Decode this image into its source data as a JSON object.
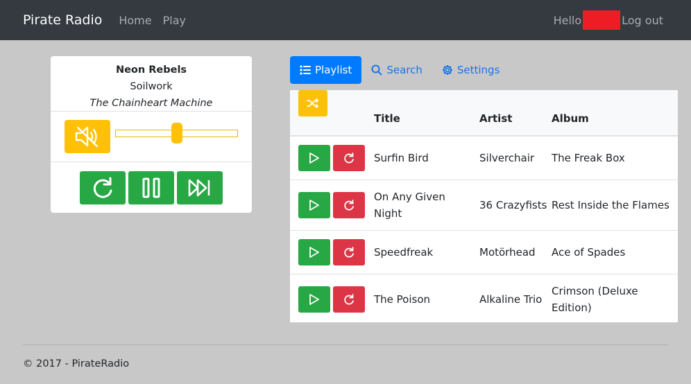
{
  "navbar": {
    "brand": "Pirate Radio",
    "links": [
      "Home",
      "Play"
    ],
    "hello": "Hello",
    "logout": "Log out"
  },
  "player": {
    "song": "Neon Rebels",
    "artist": "Soilwork",
    "album": "The Chainheart Machine",
    "volume_level": 0.5,
    "mute_icon": "volume-mute-icon",
    "controls": [
      "repeat-icon",
      "pause-icon",
      "skip-forward-icon"
    ]
  },
  "tabs": [
    {
      "label": "Playlist",
      "icon": "list-icon",
      "active": true
    },
    {
      "label": "Search",
      "icon": "search-icon",
      "active": false
    },
    {
      "label": "Settings",
      "icon": "gear-icon",
      "active": false
    }
  ],
  "playlist": {
    "columns": [
      "Title",
      "Artist",
      "Album"
    ],
    "rows": [
      {
        "title": "Surfin Bird",
        "artist": "Silverchair",
        "album": "The Freak Box"
      },
      {
        "title": "On Any Given Night",
        "artist": "36 Crazyfists",
        "album": "Rest Inside the Flames"
      },
      {
        "title": "Speedfreak",
        "artist": "Motörhead",
        "album": "Ace of Spades"
      },
      {
        "title": "The Poison",
        "artist": "Alkaline Trio",
        "album": "Crimson (Deluxe Edition)"
      }
    ]
  },
  "footer": {
    "text": "© 2017 - PirateRadio"
  },
  "colors": {
    "navbar": "#343a40",
    "primary": "#007bff",
    "success": "#28a745",
    "danger": "#dc3545",
    "warning": "#ffc107"
  }
}
